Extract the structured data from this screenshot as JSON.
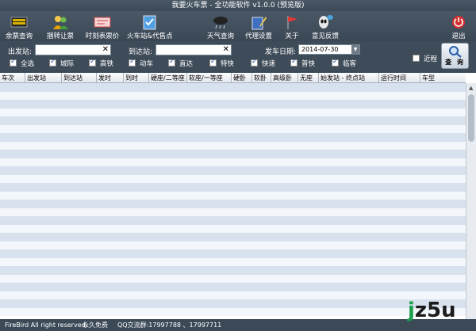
{
  "window": {
    "title": "我要火车票 - 全功能软件 v1.0.0 (预览版)"
  },
  "toolbar": {
    "items": [
      {
        "label": "余票查询",
        "icon": "train-board-icon"
      },
      {
        "label": "捆转让票",
        "icon": "people-icon"
      },
      {
        "label": "时刻表票价",
        "icon": "ticket-icon"
      },
      {
        "label": "火车站&代售点",
        "icon": "checklist-icon"
      },
      {
        "label": "天气查询",
        "icon": "cloud-rain-icon"
      },
      {
        "label": "代理设置",
        "icon": "pencil-note-icon"
      },
      {
        "label": "关于",
        "icon": "flag-icon"
      },
      {
        "label": "意见反馈",
        "icon": "alien-chat-icon"
      },
      {
        "label": "退出",
        "icon": "power-icon"
      }
    ]
  },
  "search": {
    "from_label": "出发站:",
    "to_label": "到达站:",
    "date_label": "发车日期:",
    "date_value": "2014-07-30",
    "nearby_label": "近程",
    "query_label": "查 询",
    "filters": [
      {
        "label": "全选",
        "checked": true
      },
      {
        "label": "城际",
        "checked": true
      },
      {
        "label": "高铁",
        "checked": true
      },
      {
        "label": "动车",
        "checked": true
      },
      {
        "label": "直达",
        "checked": true
      },
      {
        "label": "特快",
        "checked": true
      },
      {
        "label": "快速",
        "checked": true
      },
      {
        "label": "普快",
        "checked": true
      },
      {
        "label": "临客",
        "checked": true
      }
    ]
  },
  "table": {
    "columns": [
      "车次",
      "出发站",
      "到达站",
      "发时",
      "到时",
      "硬座/二等座",
      "软座/一等座",
      "硬卧",
      "软卧",
      "高级卧",
      "无座",
      "始发站 - 终点站",
      "运行时间",
      "车型"
    ]
  },
  "status": {
    "copyright": "FireBird All right reserved.",
    "free": "永久免费",
    "qq": "QQ交流群:17997788 、17997711"
  },
  "logo": {
    "text_j": "j",
    "text_rest": "z5u"
  },
  "colors": {
    "background": "#3c4a58",
    "row_odd": "#d8e2ee",
    "row_even": "#f3f6fa"
  }
}
